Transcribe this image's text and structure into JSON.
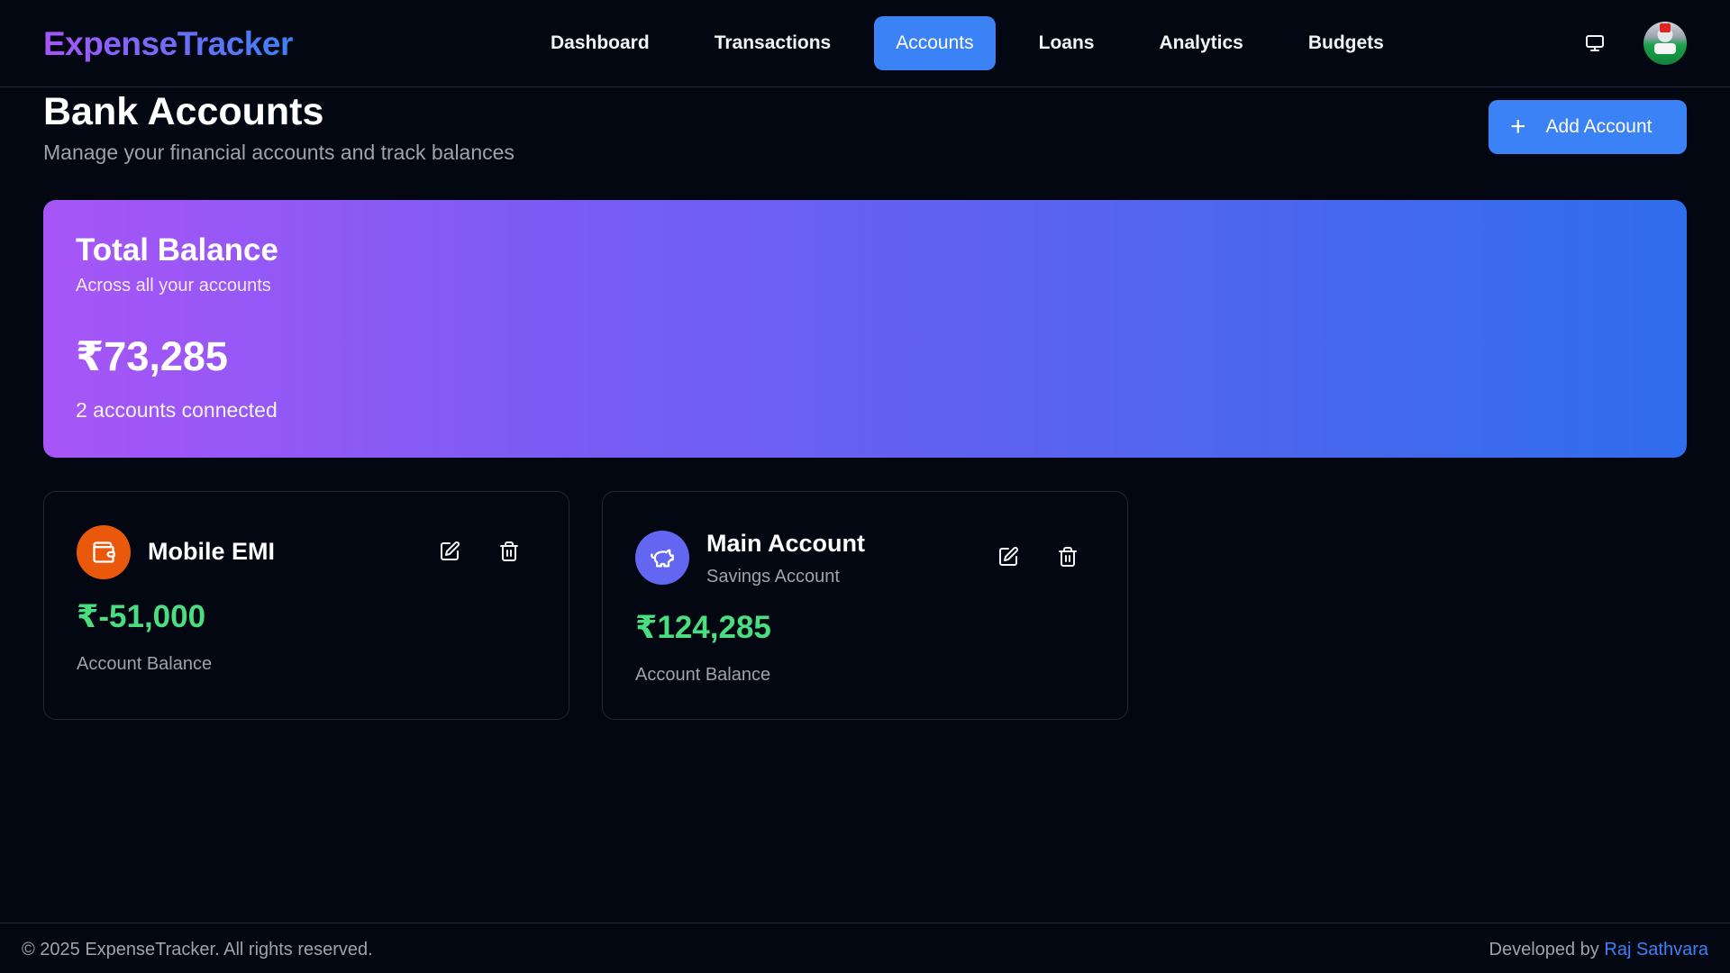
{
  "header": {
    "logo": "ExpenseTracker",
    "nav": [
      {
        "label": "Dashboard",
        "active": false
      },
      {
        "label": "Transactions",
        "active": false
      },
      {
        "label": "Accounts",
        "active": true
      },
      {
        "label": "Loans",
        "active": false
      },
      {
        "label": "Analytics",
        "active": false
      },
      {
        "label": "Budgets",
        "active": false
      }
    ],
    "monitor_icon": "monitor-icon",
    "avatar_icon": "user-avatar"
  },
  "page": {
    "title": "Bank Accounts",
    "subtitle": "Manage your financial accounts and track balances",
    "add_button": "Add Account"
  },
  "summary": {
    "title": "Total Balance",
    "subtitle": "Across all your accounts",
    "amount": "₹73,285",
    "count": "2 accounts connected"
  },
  "accounts": [
    {
      "name": "Mobile EMI",
      "type": "",
      "amount": "₹-51,000",
      "label": "Account Balance",
      "icon": "wallet-icon",
      "icon_color": "#ea580c"
    },
    {
      "name": "Main Account",
      "type": "Savings Account",
      "amount": "₹124,285",
      "label": "Account Balance",
      "icon": "piggy-bank-icon",
      "icon_color": "#6366f1"
    }
  ],
  "colors": {
    "accent": "#3b82f6",
    "positive": "#4ade80",
    "background": "#030712"
  },
  "footer": {
    "copyright": "© 2025 ExpenseTracker. All rights reserved.",
    "credit_prefix": "Developed by ",
    "credit_name": "Raj Sathvara"
  }
}
